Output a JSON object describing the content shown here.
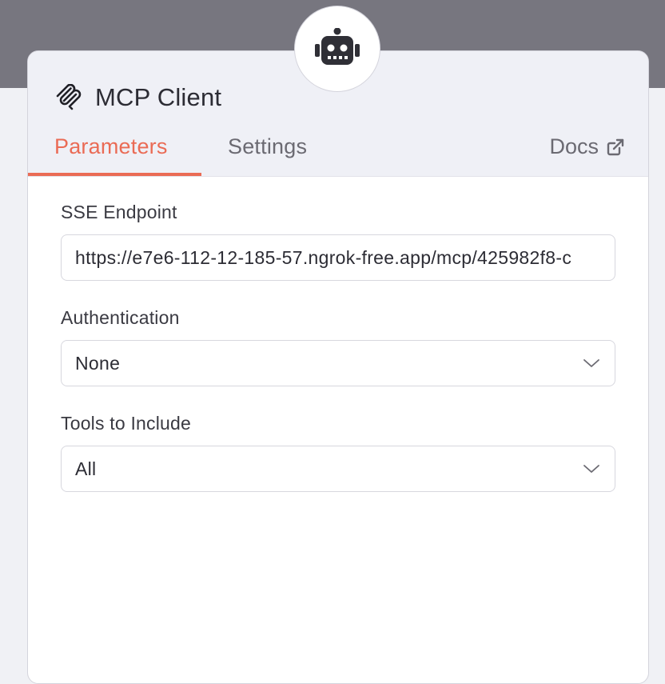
{
  "node": {
    "icon": "robot-icon",
    "title_icon": "mcp-logo-icon",
    "title": "MCP Client"
  },
  "tabs": {
    "parameters": "Parameters",
    "settings": "Settings",
    "active": "Parameters"
  },
  "docs": {
    "label": "Docs",
    "icon": "external-link-icon"
  },
  "fields": {
    "sse_endpoint": {
      "label": "SSE Endpoint",
      "value": "https://e7e6-112-12-185-57.ngrok-free.app/mcp/425982f8-c"
    },
    "authentication": {
      "label": "Authentication",
      "value": "None"
    },
    "tools_to_include": {
      "label": "Tools to Include",
      "value": "All"
    }
  },
  "colors": {
    "accent": "#ea6b55",
    "header_bg": "#eff0f6",
    "top_band": "#77767f"
  }
}
